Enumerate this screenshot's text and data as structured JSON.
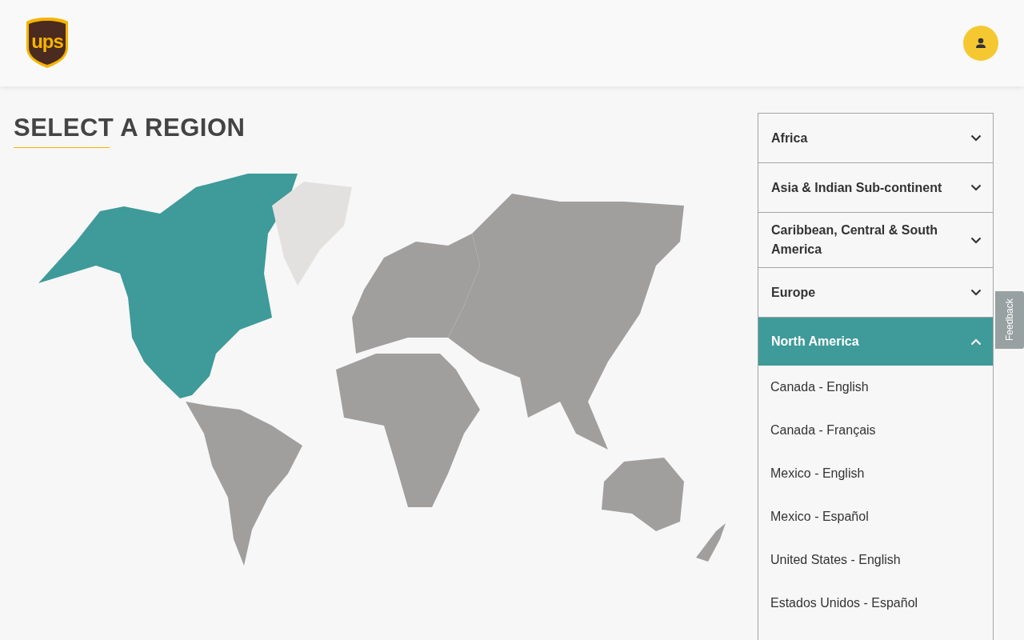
{
  "header": {
    "logo_text": "ups"
  },
  "title": "SELECT A REGION",
  "regions": [
    {
      "label": "Africa",
      "expanded": false
    },
    {
      "label": "Asia & Indian Sub-continent",
      "expanded": false
    },
    {
      "label": "Caribbean, Central & South America",
      "expanded": false
    },
    {
      "label": "Europe",
      "expanded": false
    },
    {
      "label": "North America",
      "expanded": true,
      "children": [
        {
          "label": "Canada - English"
        },
        {
          "label": "Canada - Français"
        },
        {
          "label": "Mexico - English"
        },
        {
          "label": "Mexico - Español"
        },
        {
          "label": "United States - English"
        },
        {
          "label": "Estados Unidos - Español"
        }
      ]
    }
  ],
  "feedback": "Feedback"
}
